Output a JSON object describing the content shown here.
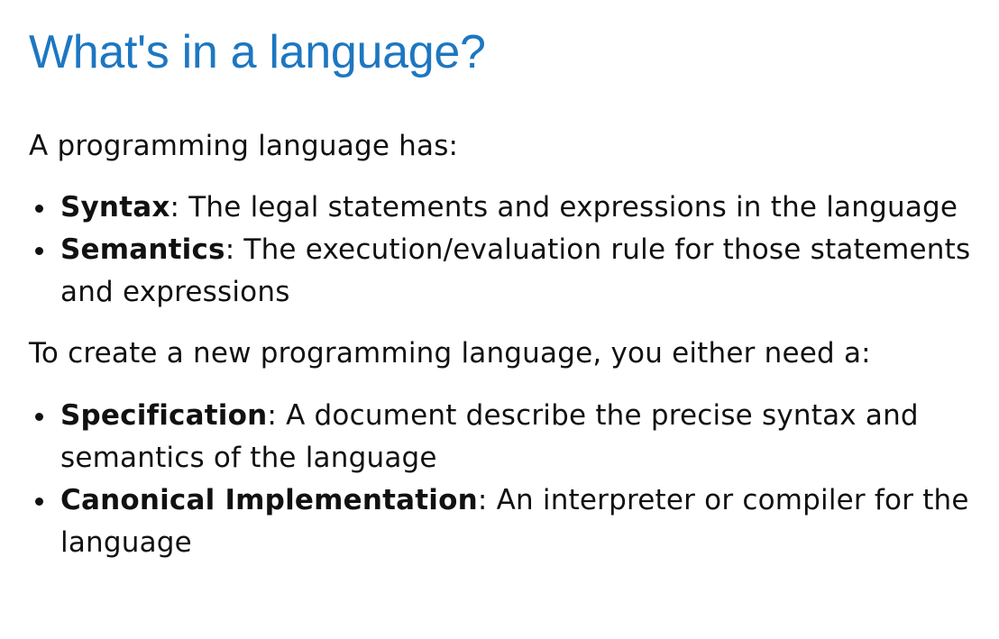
{
  "title": "What's in a language?",
  "intro_1": "A programming language has:",
  "list_1": [
    {
      "term": "Syntax",
      "sep": ":",
      "desc": " The legal statements and expressions in the language"
    },
    {
      "term": "Semantics",
      "sep": ":",
      "desc": " The execution/evaluation rule for those statements and expressions"
    }
  ],
  "intro_2": "To create a new programming language, you either need a:",
  "list_2": [
    {
      "term": "Specification",
      "sep": ":",
      "desc": " A document describe the precise syntax and semantics of the language"
    },
    {
      "term": "Canonical Implementation",
      "sep": ":",
      "desc": " An interpreter or compiler for the language"
    }
  ]
}
